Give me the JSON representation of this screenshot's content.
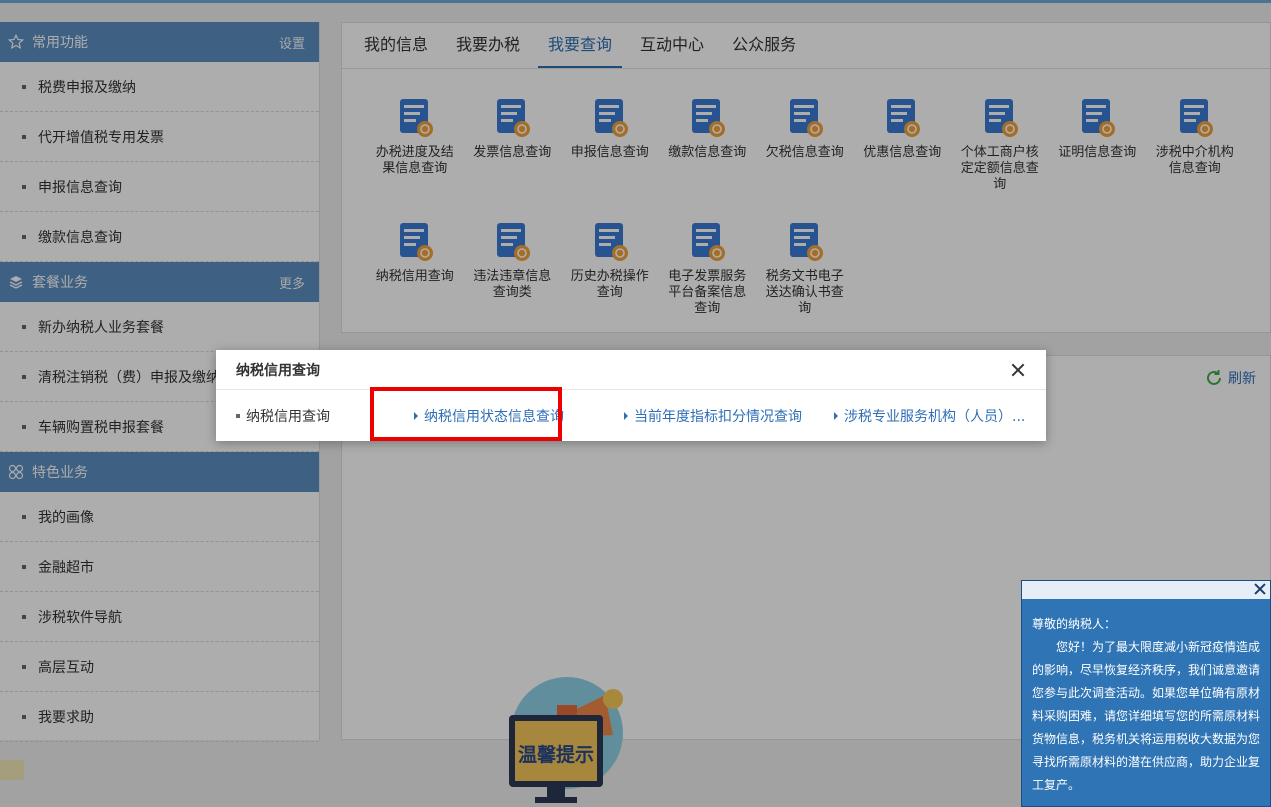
{
  "sidebar": {
    "sections": [
      {
        "title": "常用功能",
        "extra": "设置",
        "icon": "star-icon",
        "items": [
          "税费申报及缴纳",
          "代开增值税专用发票",
          "申报信息查询",
          "缴款信息查询"
        ]
      },
      {
        "title": "套餐业务",
        "extra": "更多",
        "icon": "layers-icon",
        "items": [
          "新办纳税人业务套餐",
          "清税注销税（费）申报及缴纳套餐",
          "车辆购置税申报套餐"
        ]
      },
      {
        "title": "特色业务",
        "extra": "",
        "icon": "grid-icon",
        "items": [
          "我的画像",
          "金融超市",
          "涉税软件导航",
          "高层互动",
          "我要求助"
        ]
      }
    ]
  },
  "tabs": [
    "我的信息",
    "我要办税",
    "我要查询",
    "互动中心",
    "公众服务"
  ],
  "active_tab": "我要查询",
  "tiles": [
    {
      "label": "办税进度及结果信息查询",
      "icon": "progress-query-icon"
    },
    {
      "label": "发票信息查询",
      "icon": "invoice-query-icon"
    },
    {
      "label": "申报信息查询",
      "icon": "declaration-query-icon"
    },
    {
      "label": "缴款信息查询",
      "icon": "payment-query-icon"
    },
    {
      "label": "欠税信息查询",
      "icon": "arrears-query-icon"
    },
    {
      "label": "优惠信息查询",
      "icon": "preferential-query-icon"
    },
    {
      "label": "个体工商户核定定额信息查询",
      "icon": "individual-business-icon"
    },
    {
      "label": "证明信息查询",
      "icon": "certificate-query-icon"
    },
    {
      "label": "涉税中介机构信息查询",
      "icon": "agency-query-icon"
    },
    {
      "label": "纳税信用查询",
      "icon": "tax-credit-icon"
    },
    {
      "label": "违法违章信息查询类",
      "icon": "violation-query-icon"
    },
    {
      "label": "历史办税操作查询",
      "icon": "history-query-icon"
    },
    {
      "label": "电子发票服务平台备案信息查询",
      "icon": "e-invoice-platform-icon"
    },
    {
      "label": "税务文书电子送达确认书查询",
      "icon": "document-delivery-icon"
    }
  ],
  "refresh_label": "刷新",
  "modal": {
    "title": "纳税信用查询",
    "category": "纳税信用查询",
    "links": [
      "纳税信用状态信息查询",
      "当前年度指标扣分情况查询",
      "涉税专业服务机构（人员）..."
    ]
  },
  "notice": {
    "greeting": "尊敬的纳税人：",
    "body": "您好！为了最大限度减小新冠疫情造成的影响，尽早恢复经济秩序，我们诚意邀请您参与此次调查活动。如果您单位确有原材料采购困难，请您详细填写您的所需原材料货物信息，税务机关将运用税收大数据为您寻找所需原材料的潜在供应商，助力企业复工复产。"
  },
  "mascot_text": "温馨提示",
  "colors": {
    "sidebar_header": "#5b8ec2",
    "accent": "#2f6fb6",
    "notice_bg": "#2f74b5",
    "highlight": "#ee0000"
  }
}
